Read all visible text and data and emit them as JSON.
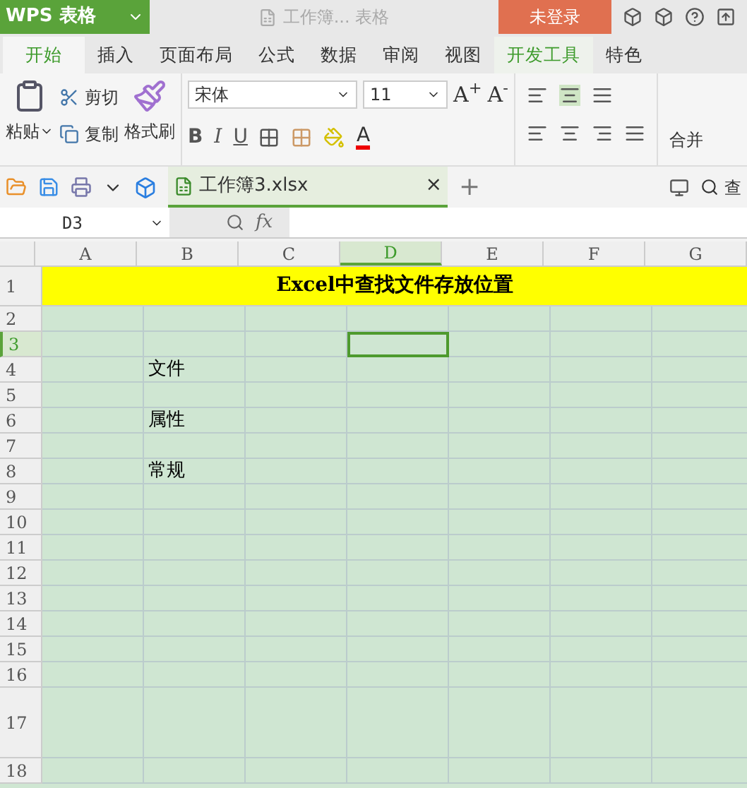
{
  "title_bar": {
    "app_name": "WPS 表格",
    "doc_title": "工作簿... 表格",
    "login": "未登录"
  },
  "menu_tabs": [
    {
      "label": "开始",
      "selected": true,
      "highlighted": false
    },
    {
      "label": "插入",
      "selected": false,
      "highlighted": false
    },
    {
      "label": "页面布局",
      "selected": false,
      "highlighted": false
    },
    {
      "label": "公式",
      "selected": false,
      "highlighted": false
    },
    {
      "label": "数据",
      "selected": false,
      "highlighted": false
    },
    {
      "label": "审阅",
      "selected": false,
      "highlighted": false
    },
    {
      "label": "视图",
      "selected": false,
      "highlighted": false
    },
    {
      "label": "开发工具",
      "selected": false,
      "highlighted": true
    },
    {
      "label": "特色",
      "selected": false,
      "highlighted": false
    }
  ],
  "ribbon": {
    "paste": "粘贴",
    "cut": "剪切",
    "copy": "复制",
    "format_painter": "格式刷",
    "font": "宋体",
    "font_size": "11",
    "grow": "A$^{+}$",
    "shrink": "A$^{-}$",
    "font_color": "A",
    "bold": "B",
    "italic": "I",
    "underline": "U",
    "merge": "合并"
  },
  "doc_tabs": [
    {
      "label": "工作簿3.xlsx",
      "selected": true
    }
  ],
  "close": "×",
  "new_tab": "+",
  "find": "查",
  "formula_bar": {
    "name_box": "D3",
    "fx": "fx"
  },
  "sheet": {
    "columns": [
      {
        "label": "A",
        "selected": false
      },
      {
        "label": "B",
        "selected": false
      },
      {
        "label": "C",
        "selected": false
      },
      {
        "label": "D",
        "selected": true
      },
      {
        "label": "E",
        "selected": false
      },
      {
        "label": "F",
        "selected": false
      },
      {
        "label": "G",
        "selected": false
      }
    ],
    "rows": [
      {
        "label": "1",
        "kind": "title",
        "selected": false,
        "text": "Excel中查找文件存放位置"
      },
      {
        "label": "2",
        "kind": "normal",
        "selected": false
      },
      {
        "label": "3",
        "kind": "normal",
        "selected": true
      },
      {
        "label": "4",
        "kind": "normal",
        "selected": false,
        "cells": {
          "B": "文件"
        }
      },
      {
        "label": "5",
        "kind": "normal",
        "selected": false
      },
      {
        "label": "6",
        "kind": "normal",
        "selected": false,
        "cells": {
          "B": "属性"
        }
      },
      {
        "label": "7",
        "kind": "normal",
        "selected": false
      },
      {
        "label": "8",
        "kind": "normal",
        "selected": false,
        "cells": {
          "B": "常规"
        }
      },
      {
        "label": "9",
        "kind": "normal",
        "selected": false
      },
      {
        "label": "10",
        "kind": "normal",
        "selected": false
      },
      {
        "label": "11",
        "kind": "normal",
        "selected": false
      },
      {
        "label": "12",
        "kind": "normal",
        "selected": false
      },
      {
        "label": "13",
        "kind": "normal",
        "selected": false
      },
      {
        "label": "14",
        "kind": "normal",
        "selected": false
      },
      {
        "label": "15",
        "kind": "normal",
        "selected": false
      },
      {
        "label": "16",
        "kind": "normal",
        "selected": false
      },
      {
        "label": "17",
        "kind": "tall",
        "selected": false
      },
      {
        "label": "18",
        "kind": "normal",
        "selected": false
      }
    ]
  }
}
